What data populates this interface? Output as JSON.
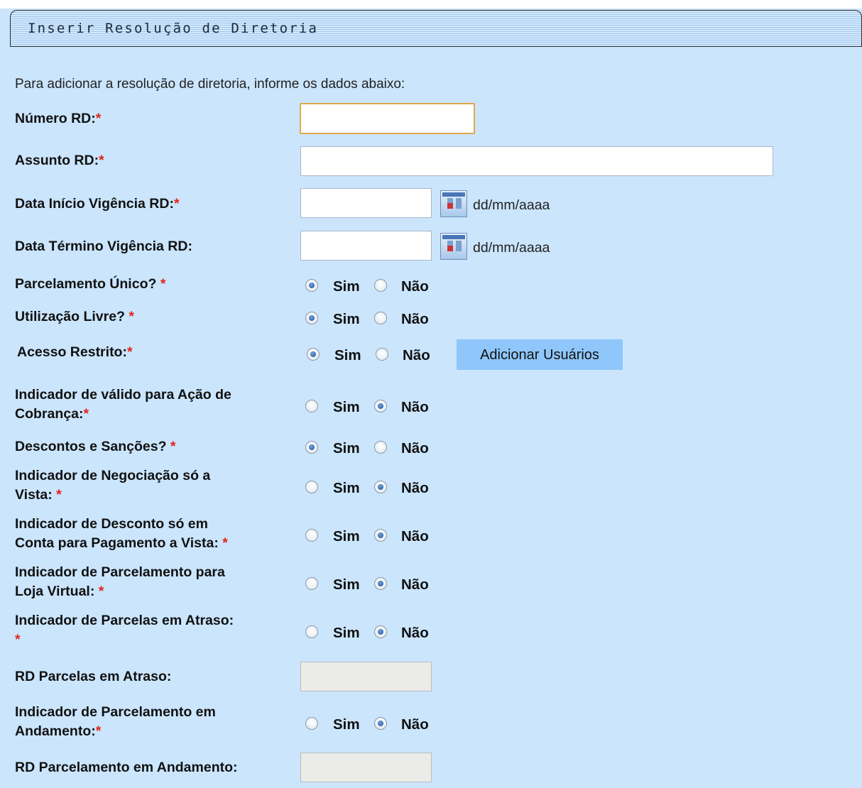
{
  "panel": {
    "title": "Inserir Resolução de Diretoria"
  },
  "intro": "Para adicionar a resolução de diretoria, informe os dados abaixo:",
  "required_mark": "*",
  "fields": {
    "numero_rd": {
      "label": "Número RD:",
      "value": ""
    },
    "assunto_rd": {
      "label": "Assunto RD:",
      "value": ""
    },
    "data_inicio": {
      "label": "Data Início Vigência RD:",
      "value": "",
      "format_hint": "dd/mm/aaaa",
      "icon": "calendar-icon"
    },
    "data_termino": {
      "label": "Data Término Vigência RD:",
      "value": "",
      "format_hint": "dd/mm/aaaa",
      "icon": "calendar-icon"
    },
    "rd_parcelas_atraso": {
      "label": "RD Parcelas em Atraso:",
      "value": "",
      "disabled": true
    },
    "rd_parcelamento_andamento": {
      "label": "RD Parcelamento em Andamento:",
      "value": "",
      "disabled": true
    }
  },
  "radio_options": {
    "yes": "Sim",
    "no": "Não"
  },
  "radio_groups": {
    "parcelamento_unico": {
      "label": "Parcelamento Único?",
      "selected": "Sim"
    },
    "utilizacao_livre": {
      "label": "Utilização Livre?",
      "selected": "Sim"
    },
    "acesso_restrito": {
      "label": "Acesso Restrito:",
      "selected": "Sim"
    },
    "acao_cobranca": {
      "label_line1": "Indicador de válido para Ação de",
      "label_line2": "Cobrança:",
      "selected": "Não"
    },
    "descontos_sancoes": {
      "label": "Descontos e Sanções?",
      "selected": "Sim"
    },
    "negociacao_vista": {
      "label_line1": "Indicador de Negociação só a",
      "label_line2": "Vista:",
      "selected": "Não"
    },
    "desconto_conta_vista": {
      "label_line1": "Indicador de Desconto só em",
      "label_line2": "Conta para Pagamento a Vista:",
      "selected": "Não"
    },
    "parcelamento_loja_virtual": {
      "label_line1": "Indicador de Parcelamento para",
      "label_line2": "Loja Virtual:",
      "selected": "Não"
    },
    "parcelas_atraso": {
      "label_line1": "Indicador de Parcelas em Atraso:",
      "label_line2": "",
      "selected": "Não"
    },
    "parcelamento_andamento": {
      "label_line1": "Indicador de Parcelamento em",
      "label_line2": "Andamento:",
      "selected": "Não"
    }
  },
  "buttons": {
    "adicionar_usuarios": "Adicionar Usuários"
  },
  "colors": {
    "background": "#cbe5fd",
    "required": "#e0261a",
    "button": "#8fc7fb",
    "focus_border": "#e0a94a"
  }
}
